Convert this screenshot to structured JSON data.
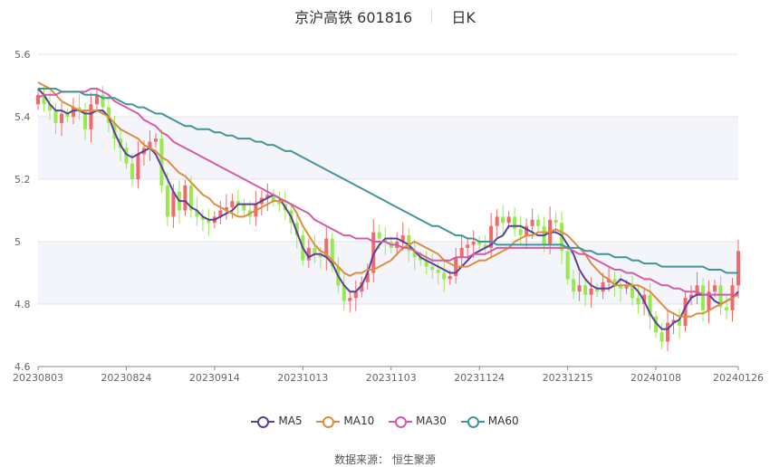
{
  "header": {
    "stock": "京沪高铁 601816",
    "period": "日K"
  },
  "legend": [
    {
      "name": "MA5",
      "color": "#5b3f99"
    },
    {
      "name": "MA10",
      "color": "#dd8d3e"
    },
    {
      "name": "MA30",
      "color": "#d55ba8"
    },
    {
      "name": "MA60",
      "color": "#3f9698"
    }
  ],
  "source": "数据来源：  恒生聚源",
  "colors": {
    "up": "#f06a6a",
    "down": "#96ea4f",
    "band": "#f4f5fb",
    "grid": "#e3e3e3"
  },
  "chart_data": {
    "type": "candlestick",
    "y_ticks": [
      "5.6",
      "5.4",
      "5.2",
      "5",
      "4.8",
      "4.6"
    ],
    "ylim": [
      4.6,
      5.6
    ],
    "x_tick_labels": [
      "20230803",
      "20230824",
      "20230914",
      "20231013",
      "20231103",
      "20231124",
      "20231215",
      "20240108",
      "20240126"
    ],
    "x_tick_index": [
      0,
      15,
      30,
      45,
      60,
      75,
      90,
      105,
      119
    ],
    "n_days": 120,
    "closes": [
      5.47,
      5.44,
      5.42,
      5.38,
      5.41,
      5.4,
      5.43,
      5.42,
      5.36,
      5.44,
      5.47,
      5.43,
      5.38,
      5.33,
      5.3,
      5.25,
      5.2,
      5.28,
      5.3,
      5.32,
      5.33,
      5.18,
      5.08,
      5.16,
      5.1,
      5.18,
      5.1,
      5.08,
      5.07,
      5.06,
      5.08,
      5.1,
      5.11,
      5.13,
      5.12,
      5.1,
      5.08,
      5.12,
      5.14,
      5.15,
      5.13,
      5.12,
      5.1,
      5.06,
      5.02,
      4.94,
      4.98,
      4.96,
      4.95,
      5.01,
      4.92,
      4.86,
      4.81,
      4.82,
      4.84,
      4.87,
      4.9,
      5.03,
      5.01,
      5.0,
      4.98,
      5.0,
      5.02,
      4.97,
      4.95,
      4.94,
      4.92,
      4.91,
      4.9,
      4.88,
      4.89,
      4.95,
      4.98,
      4.99,
      5.0,
      4.99,
      4.98,
      5.05,
      5.08,
      5.06,
      5.08,
      5.04,
      5.02,
      5.05,
      5.07,
      5.05,
      4.99,
      5.07,
      5.06,
      4.97,
      4.88,
      4.84,
      4.86,
      4.83,
      4.85,
      4.84,
      4.87,
      4.88,
      4.86,
      4.85,
      4.86,
      4.82,
      4.8,
      4.83,
      4.76,
      4.71,
      4.68,
      4.74,
      4.75,
      4.73,
      4.82,
      4.83,
      4.86,
      4.78,
      4.84,
      4.86,
      4.79,
      4.78,
      4.86,
      4.97
    ],
    "series": [
      {
        "name": "MA5",
        "values": [
          5.49,
          5.47,
          5.44,
          5.42,
          5.42,
          5.41,
          5.42,
          5.42,
          5.41,
          5.41,
          5.42,
          5.42,
          5.4,
          5.35,
          5.31,
          5.28,
          5.27,
          5.28,
          5.29,
          5.3,
          5.28,
          5.24,
          5.2,
          5.16,
          5.13,
          5.13,
          5.11,
          5.1,
          5.08,
          5.07,
          5.07,
          5.08,
          5.09,
          5.1,
          5.12,
          5.12,
          5.12,
          5.12,
          5.13,
          5.14,
          5.15,
          5.14,
          5.11,
          5.08,
          5.03,
          4.98,
          4.95,
          4.96,
          4.96,
          4.95,
          4.93,
          4.89,
          4.86,
          4.84,
          4.84,
          4.86,
          4.9,
          4.96,
          4.99,
          5.01,
          5.01,
          5.01,
          5.0,
          4.99,
          4.97,
          4.95,
          4.94,
          4.93,
          4.92,
          4.91,
          4.9,
          4.9,
          4.92,
          4.94,
          4.96,
          4.97,
          4.98,
          4.99,
          5.01,
          5.02,
          5.05,
          5.05,
          5.05,
          5.04,
          5.03,
          5.02,
          5.02,
          5.03,
          5.03,
          5.02,
          4.99,
          4.96,
          4.91,
          4.88,
          4.86,
          4.85,
          4.85,
          4.85,
          4.86,
          4.88,
          4.87,
          4.86,
          4.84,
          4.81,
          4.77,
          4.74,
          4.72,
          4.72,
          4.74,
          4.75,
          4.79,
          4.82,
          4.83,
          4.83,
          4.83,
          4.81,
          4.8,
          4.81,
          4.82,
          4.84
        ]
      },
      {
        "name": "MA10",
        "values": [
          5.51,
          5.5,
          5.49,
          5.47,
          5.45,
          5.44,
          5.43,
          5.42,
          5.42,
          5.42,
          5.42,
          5.41,
          5.4,
          5.38,
          5.36,
          5.35,
          5.34,
          5.33,
          5.31,
          5.3,
          5.29,
          5.27,
          5.26,
          5.24,
          5.22,
          5.21,
          5.19,
          5.17,
          5.15,
          5.14,
          5.12,
          5.11,
          5.1,
          5.09,
          5.08,
          5.08,
          5.09,
          5.1,
          5.11,
          5.12,
          5.13,
          5.13,
          5.13,
          5.12,
          5.09,
          5.05,
          5.02,
          4.99,
          4.97,
          4.96,
          4.94,
          4.92,
          4.9,
          4.89,
          4.9,
          4.9,
          4.91,
          4.91,
          4.92,
          4.93,
          4.94,
          4.96,
          4.98,
          4.99,
          5.0,
          4.99,
          4.98,
          4.97,
          4.96,
          4.94,
          4.93,
          4.92,
          4.92,
          4.92,
          4.93,
          4.94,
          4.94,
          4.95,
          4.96,
          4.97,
          4.98,
          5.0,
          5.01,
          5.02,
          5.02,
          5.03,
          5.03,
          5.03,
          5.04,
          5.03,
          5.02,
          5.0,
          4.98,
          4.96,
          4.93,
          4.91,
          4.89,
          4.88,
          4.86,
          4.86,
          4.86,
          4.86,
          4.86,
          4.85,
          4.84,
          4.82,
          4.8,
          4.78,
          4.77,
          4.76,
          4.76,
          4.76,
          4.77,
          4.77,
          4.78,
          4.79,
          4.8,
          4.81,
          4.82,
          4.83
        ]
      },
      {
        "name": "MA30",
        "values": [
          5.46,
          5.47,
          5.47,
          5.47,
          5.48,
          5.48,
          5.48,
          5.48,
          5.48,
          5.49,
          5.49,
          5.48,
          5.47,
          5.45,
          5.44,
          5.43,
          5.42,
          5.41,
          5.39,
          5.38,
          5.37,
          5.35,
          5.34,
          5.32,
          5.31,
          5.3,
          5.29,
          5.28,
          5.27,
          5.26,
          5.25,
          5.24,
          5.23,
          5.22,
          5.21,
          5.2,
          5.19,
          5.18,
          5.17,
          5.16,
          5.15,
          5.14,
          5.13,
          5.12,
          5.11,
          5.1,
          5.09,
          5.07,
          5.06,
          5.05,
          5.04,
          5.03,
          5.02,
          5.02,
          5.01,
          5.01,
          5.01,
          5.0,
          5.0,
          5.0,
          4.99,
          4.99,
          4.98,
          4.98,
          4.97,
          4.96,
          4.95,
          4.94,
          4.94,
          4.94,
          4.94,
          4.95,
          4.95,
          4.95,
          4.96,
          4.96,
          4.96,
          4.97,
          4.98,
          4.98,
          4.98,
          4.98,
          4.98,
          4.98,
          4.98,
          4.98,
          4.98,
          4.98,
          4.98,
          4.98,
          4.98,
          4.97,
          4.96,
          4.96,
          4.95,
          4.94,
          4.93,
          4.92,
          4.91,
          4.91,
          4.9,
          4.9,
          4.89,
          4.88,
          4.88,
          4.87,
          4.86,
          4.86,
          4.85,
          4.85,
          4.84,
          4.84,
          4.84,
          4.83,
          4.83,
          4.83,
          4.83,
          4.83,
          4.83,
          4.83
        ]
      },
      {
        "name": "MA60",
        "values": [
          5.49,
          5.49,
          5.49,
          5.49,
          5.48,
          5.48,
          5.48,
          5.48,
          5.47,
          5.47,
          5.47,
          5.46,
          5.46,
          5.46,
          5.45,
          5.44,
          5.44,
          5.43,
          5.43,
          5.42,
          5.41,
          5.41,
          5.4,
          5.39,
          5.38,
          5.37,
          5.37,
          5.36,
          5.36,
          5.36,
          5.35,
          5.35,
          5.34,
          5.34,
          5.33,
          5.33,
          5.33,
          5.32,
          5.32,
          5.31,
          5.31,
          5.3,
          5.29,
          5.29,
          5.28,
          5.27,
          5.26,
          5.25,
          5.24,
          5.23,
          5.22,
          5.21,
          5.2,
          5.19,
          5.18,
          5.17,
          5.16,
          5.15,
          5.14,
          5.13,
          5.12,
          5.11,
          5.1,
          5.09,
          5.08,
          5.07,
          5.06,
          5.05,
          5.05,
          5.04,
          5.03,
          5.02,
          5.02,
          5.01,
          5.01,
          5.0,
          5.0,
          5.0,
          4.99,
          4.99,
          4.99,
          4.99,
          4.99,
          4.99,
          4.99,
          4.99,
          4.99,
          4.99,
          4.99,
          4.99,
          4.98,
          4.98,
          4.98,
          4.97,
          4.97,
          4.96,
          4.96,
          4.96,
          4.95,
          4.95,
          4.95,
          4.94,
          4.94,
          4.93,
          4.93,
          4.93,
          4.92,
          4.92,
          4.92,
          4.92,
          4.92,
          4.92,
          4.92,
          4.92,
          4.91,
          4.91,
          4.91,
          4.9,
          4.9,
          4.9
        ]
      }
    ]
  }
}
